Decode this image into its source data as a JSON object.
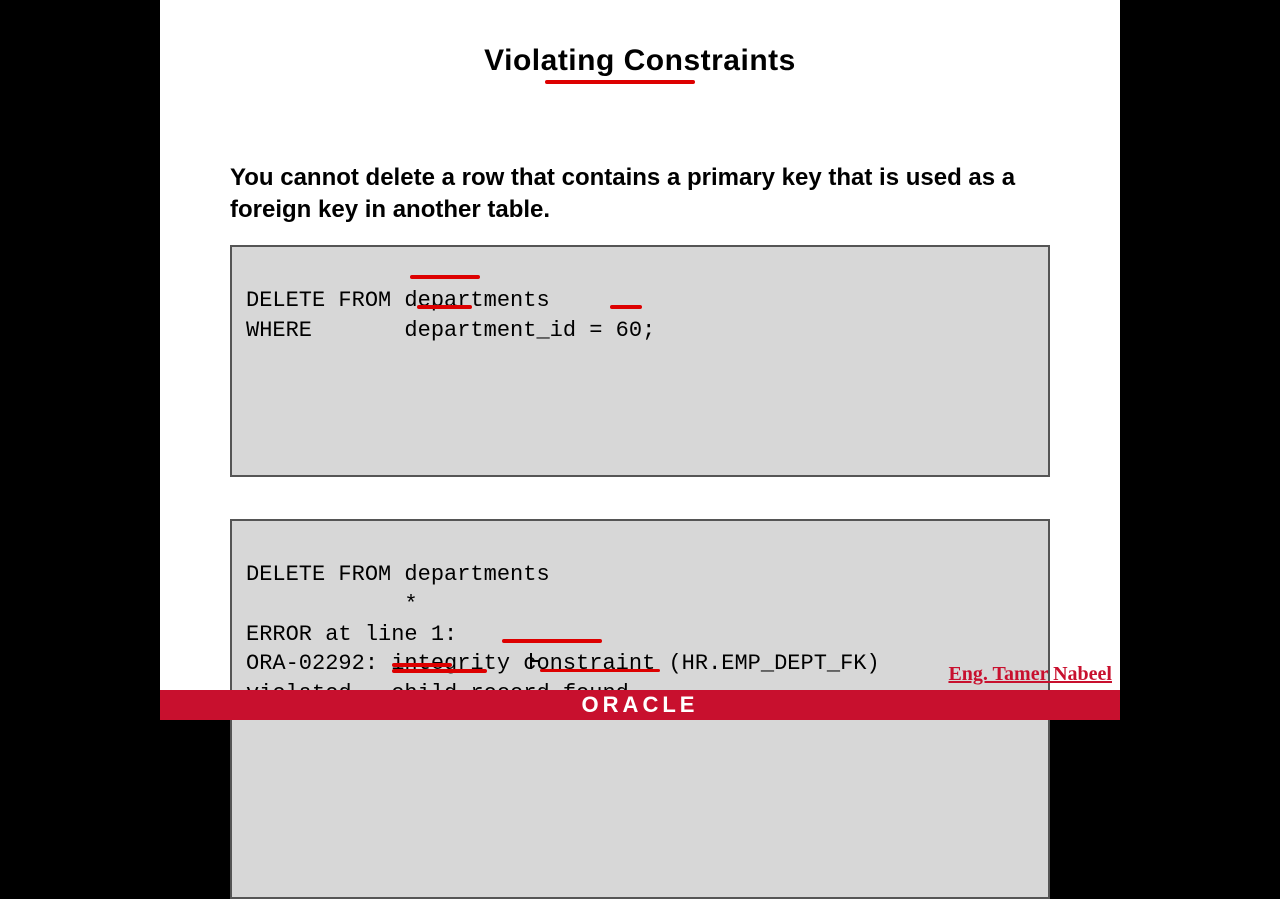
{
  "title": "Violating Constraints",
  "description": "You cannot delete a row that contains a primary key that is used as a foreign key in another table.",
  "code1": {
    "line1": "DELETE FROM departments",
    "line2": "WHERE       department_id = 60;"
  },
  "code2": {
    "line1": "DELETE FROM departments",
    "line2": "            *",
    "line3": "ERROR at line 1:",
    "line4": "ORA-02292: integrity constraint (HR.EMP_DEPT_FK)",
    "line5": "violated - child record found"
  },
  "footer": {
    "logo": "ORACLE",
    "author": "Eng. Tamer Nabeel"
  },
  "annotations": {
    "color": "#d00"
  }
}
